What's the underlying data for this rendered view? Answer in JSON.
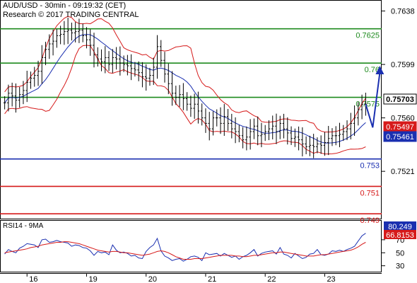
{
  "header": {
    "title": "AUD/USD - 30min - 09:19:32 (CET)",
    "subtitle": "Research © 2017 TRADING CENTRAL"
  },
  "chart_data": [
    {
      "type": "candlestick",
      "title": "AUD/USD - 30min - 09:19:32 (CET)",
      "ylim": [
        0.7487,
        0.7645
      ],
      "y_ticks": [
        "0.7638",
        "0.7599",
        "0.7560",
        "0.7521"
      ],
      "x_ticks": [
        "16",
        "19",
        "20",
        "21",
        "22",
        "23"
      ],
      "x_tick_index": [
        6,
        22,
        38,
        54,
        70,
        86
      ],
      "n_bars": 98,
      "close": [
        0.7571,
        0.7578,
        0.7576,
        0.7573,
        0.7577,
        0.758,
        0.7586,
        0.7589,
        0.7591,
        0.7594,
        0.7604,
        0.761,
        0.7614,
        0.7616,
        0.762,
        0.7621,
        0.7623,
        0.7624,
        0.7622,
        0.7623,
        0.7624,
        0.762,
        0.7617,
        0.7613,
        0.7606,
        0.7603,
        0.7601,
        0.7604,
        0.7599,
        0.7604,
        0.7603,
        0.76,
        0.7599,
        0.7598,
        0.7596,
        0.7595,
        0.7593,
        0.759,
        0.7589,
        0.7591,
        0.7597,
        0.7612,
        0.7602,
        0.7592,
        0.7585,
        0.7578,
        0.7575,
        0.7577,
        0.7574,
        0.757,
        0.7567,
        0.757,
        0.7565,
        0.756,
        0.7556,
        0.7552,
        0.756,
        0.756,
        0.7556,
        0.7561,
        0.7556,
        0.7552,
        0.755,
        0.7547,
        0.7544,
        0.7546,
        0.755,
        0.7554,
        0.7547,
        0.7548,
        0.755,
        0.7552,
        0.7554,
        0.755,
        0.7556,
        0.7552,
        0.7549,
        0.7545,
        0.7546,
        0.7544,
        0.7541,
        0.7539,
        0.754,
        0.7539,
        0.7541,
        0.754,
        0.7542,
        0.7545,
        0.7547,
        0.7547,
        0.7548,
        0.755,
        0.7552,
        0.7556,
        0.756,
        0.7566,
        0.757,
        0.757
      ],
      "levels": [
        {
          "value": 0.7625,
          "label": "0.7625",
          "color": "#1e8a1e"
        },
        {
          "value": 0.76,
          "label": "0.76",
          "color": "#1e8a1e"
        },
        {
          "value": 0.7575,
          "label": "0.7575",
          "color": "#1e8a1e"
        },
        {
          "value": 0.753,
          "label": "0.753",
          "color": "#1a2fb0"
        },
        {
          "value": 0.751,
          "label": "0.751",
          "color": "#d61a1a"
        },
        {
          "value": 0.749,
          "label": "0.749",
          "color": "#d61a1a"
        }
      ],
      "price_tags": [
        {
          "value": 0.75703,
          "label": "0.75703",
          "bg": "#ffffff",
          "fg": "#000000"
        },
        {
          "value": 0.75497,
          "label": "0.75497",
          "bg": "#d61a1a",
          "fg": "#ffffff"
        },
        {
          "value": 0.75461,
          "label": "0.75461",
          "bg": "#1a2fb0",
          "fg": "#ffffff"
        }
      ],
      "projection": [
        0.757,
        0.7553,
        0.7598
      ],
      "colors": {
        "candles": "#000000",
        "bollinger": "#d61a1a",
        "ma": "#1a2fb0",
        "arrow": "#1a2fb0"
      }
    },
    {
      "type": "line",
      "title": "RSI14 - 9MA",
      "ylim": [
        22,
        84
      ],
      "y_ticks": [
        "70",
        "50",
        "30"
      ],
      "series": [
        {
          "name": "RSI14",
          "color": "#1a2fb0",
          "values": [
            48,
            55,
            52,
            50,
            57,
            60,
            64,
            63,
            62,
            58,
            70,
            71,
            66,
            67,
            69,
            67,
            66,
            65,
            60,
            62,
            61,
            58,
            57,
            53,
            46,
            52,
            50,
            51,
            47,
            62,
            54,
            50,
            51,
            49,
            45,
            46,
            42,
            41,
            52,
            58,
            62,
            72,
            53,
            45,
            42,
            38,
            40,
            41,
            37,
            40,
            44,
            45,
            43,
            38,
            50,
            47,
            48,
            49,
            45,
            49,
            46,
            43,
            45,
            40,
            44,
            46,
            50,
            55,
            45,
            49,
            51,
            52,
            53,
            48,
            58,
            48,
            46,
            42,
            49,
            45,
            41,
            43,
            48,
            49,
            55,
            47,
            46,
            48,
            53,
            52,
            54,
            52,
            55,
            57,
            60,
            68,
            76,
            80
          ]
        },
        {
          "name": "9MA",
          "color": "#d61a1a",
          "values": [
            50,
            51,
            52,
            53,
            54,
            55,
            56,
            58,
            59,
            60,
            62,
            63,
            64,
            65,
            66,
            66,
            67,
            67,
            66,
            65,
            64,
            62,
            60,
            58,
            56,
            54,
            53,
            52,
            51,
            52,
            52,
            51,
            50,
            50,
            49,
            48,
            47,
            46,
            47,
            48,
            50,
            52,
            53,
            52,
            50,
            47,
            44,
            42,
            40,
            40,
            40,
            41,
            41,
            41,
            42,
            43,
            44,
            45,
            46,
            46,
            46,
            46,
            45,
            45,
            44,
            44,
            45,
            46,
            46,
            47,
            48,
            49,
            50,
            50,
            51,
            51,
            50,
            49,
            48,
            47,
            46,
            45,
            45,
            45,
            46,
            47,
            47,
            48,
            49,
            50,
            51,
            52,
            53,
            54,
            56,
            59,
            63,
            66
          ]
        }
      ],
      "value_tags": [
        {
          "value": 80.249,
          "label": "80.249",
          "bg": "#1a2fb0",
          "fg": "#ffffff"
        },
        {
          "value": 66.8153,
          "label": "66.8153",
          "bg": "#d61a1a",
          "fg": "#ffffff"
        }
      ]
    }
  ]
}
